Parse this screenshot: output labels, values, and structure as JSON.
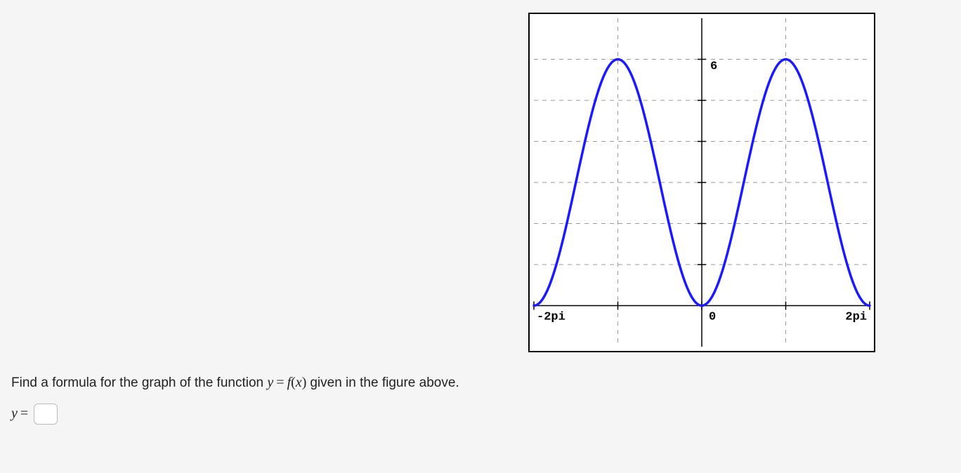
{
  "chart_data": {
    "type": "line",
    "title": "",
    "xlabel": "",
    "ylabel": "",
    "xlim": [
      -6.2832,
      6.2832
    ],
    "ylim": [
      -1,
      7
    ],
    "xticks": [
      {
        "value": -6.2832,
        "label": "-2pi"
      },
      {
        "value": 0,
        "label": "0"
      },
      {
        "value": 6.2832,
        "label": "2pi"
      }
    ],
    "yticks": [
      {
        "value": 6,
        "label": "6"
      }
    ],
    "grid_y": [
      1,
      2,
      3,
      4,
      5,
      6
    ],
    "grid_x_minor": [
      -3.1416,
      3.1416
    ],
    "series": [
      {
        "name": "f(x)",
        "formula": "3 - 3*cos(x)",
        "color": "#1a1aff",
        "amplitude": 3,
        "vertical_shift": 3,
        "period": 6.2832,
        "sample_points_x": [
          -6.2832,
          -5.7596,
          -5.236,
          -4.7124,
          -4.1888,
          -3.6652,
          -3.1416,
          -2.618,
          -2.0944,
          -1.5708,
          -1.0472,
          -0.5236,
          0,
          0.5236,
          1.0472,
          1.5708,
          2.0944,
          2.618,
          3.1416,
          3.6652,
          4.1888,
          4.7124,
          5.236,
          5.7596,
          6.2832
        ],
        "sample_points_y": [
          0,
          0.402,
          1.5,
          3,
          4.5,
          5.598,
          6,
          5.598,
          4.5,
          3,
          1.5,
          0.402,
          0,
          0.402,
          1.5,
          3,
          4.5,
          5.598,
          6,
          5.598,
          4.5,
          3,
          1.5,
          0.402,
          0
        ]
      }
    ]
  },
  "question": {
    "prompt_prefix": "Find a formula for the graph of the function ",
    "equation_lhs_y": "y",
    "equation_eq": "=",
    "equation_rhs_f": "f",
    "equation_rhs_open": "(",
    "equation_rhs_x": "x",
    "equation_rhs_close": ")",
    "prompt_suffix": " given in the figure above.",
    "answer_label_y": "y",
    "answer_label_eq": "=",
    "answer_value": ""
  }
}
